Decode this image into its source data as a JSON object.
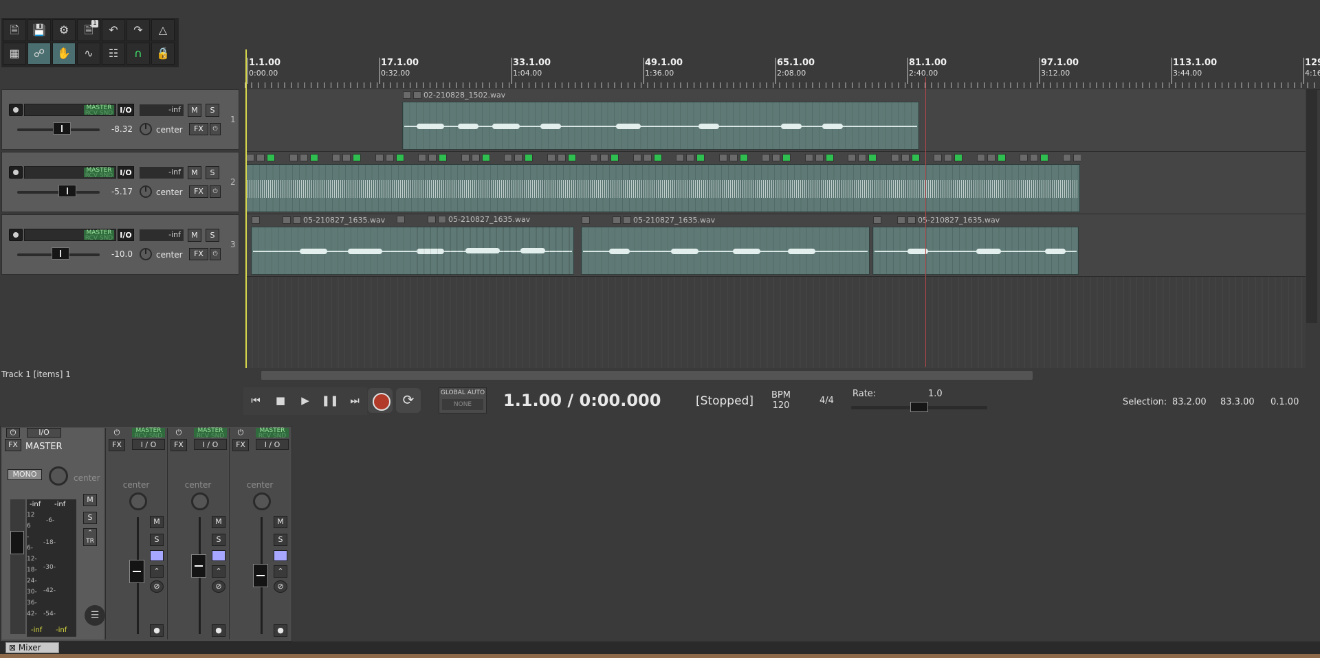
{
  "toolbar": {
    "row1": [
      "new-project",
      "save-project",
      "project-settings",
      "undo-history",
      "undo",
      "redo",
      "metronome"
    ],
    "row2": [
      "ripple-edit",
      "item-grouping",
      "envelope-points",
      "snap",
      "grid",
      "auto-crossfade",
      "lock"
    ],
    "lock_label": "LOCK",
    "undo_badge": "1"
  },
  "ruler": {
    "markers": [
      {
        "bar": "1.1.00",
        "time": "0:00.00"
      },
      {
        "bar": "17.1.00",
        "time": "0:32.00"
      },
      {
        "bar": "33.1.00",
        "time": "1:04.00"
      },
      {
        "bar": "49.1.00",
        "time": "1:36.00"
      },
      {
        "bar": "65.1.00",
        "time": "2:08.00"
      },
      {
        "bar": "81.1.00",
        "time": "2:40.00"
      },
      {
        "bar": "97.1.00",
        "time": "3:12.00"
      },
      {
        "bar": "113.1.00",
        "time": "3:44.00"
      },
      {
        "bar": "129",
        "time": "4:16"
      }
    ]
  },
  "tracks": [
    {
      "num": "1",
      "route": "MASTER",
      "route_sub": "RCV SND",
      "io": "I/O",
      "vol_readout": "-inf",
      "mute": "M",
      "solo": "S",
      "volume_db": "-8.32",
      "pan": "center",
      "fx": "FX",
      "fader_pos": 0.52
    },
    {
      "num": "2",
      "route": "MASTER",
      "route_sub": "RCV SND",
      "io": "I/O",
      "vol_readout": "-inf",
      "mute": "M",
      "solo": "S",
      "volume_db": "-5.17",
      "pan": "center",
      "fx": "FX",
      "fader_pos": 0.58
    },
    {
      "num": "3",
      "route": "MASTER",
      "route_sub": "RCV SND",
      "io": "I/O",
      "vol_readout": "-inf",
      "mute": "M",
      "solo": "S",
      "volume_db": "-10.0",
      "pan": "center",
      "fx": "FX",
      "fader_pos": 0.5
    }
  ],
  "items": {
    "track1": {
      "name": "02-210828_1502.wav"
    },
    "track3": [
      {
        "name": "05-210827_1635.wav"
      },
      {
        "name": "05-210827_1635.wav"
      },
      {
        "name": "05-210827_1635.wav"
      },
      {
        "name": "05-210827_1635.wav"
      }
    ]
  },
  "status": {
    "tcp_status": "Track 1 [items] 1"
  },
  "transport": {
    "position": "1.1.00 / 0:00.000",
    "state": "[Stopped]",
    "bpm_label": "BPM",
    "bpm_value": "120",
    "time_sig": "4/4",
    "rate_label": "Rate:",
    "rate_value": "1.0",
    "global_auto": "GLOBAL AUTO",
    "global_auto_mode": "NONE",
    "selection_label": "Selection:",
    "selection_start": "83.2.00",
    "selection_end": "83.3.00",
    "selection_length": "0.1.00"
  },
  "mixer": {
    "master": {
      "name": "MASTER",
      "fx": "FX",
      "io": "I/O",
      "mono": "MONO",
      "pan": "center",
      "mute": "M",
      "solo": "S",
      "tr": "TR",
      "meter_left_top": "-inf",
      "meter_right_top": "-inf",
      "meter_left_bottom": "-inf",
      "meter_right_bottom": "-inf",
      "scale_outer": [
        "12",
        "6",
        "-",
        "6-",
        "12-",
        "18-",
        "24-",
        "30-",
        "36-",
        "42-"
      ],
      "scale_inner": [
        "-6-",
        "-18-",
        "-30-",
        "-42-",
        "-54-"
      ]
    },
    "strips": [
      {
        "route": "MASTER",
        "route_sub": "RCV SND",
        "io": "I / O",
        "fx": "FX",
        "pan": "center",
        "mute": "M",
        "solo": "S"
      },
      {
        "route": "MASTER",
        "route_sub": "RCV SND",
        "io": "I / O",
        "fx": "FX",
        "pan": "center",
        "mute": "M",
        "solo": "S"
      },
      {
        "route": "MASTER",
        "route_sub": "RCV SND",
        "io": "I / O",
        "fx": "FX",
        "pan": "center",
        "mute": "M",
        "solo": "S"
      }
    ],
    "tab_label": "Mixer"
  },
  "colors": {
    "item": "#5f7a76",
    "route_green": "#2f6b3c",
    "play_cursor": "#d8d84c",
    "record": "#b13a28"
  }
}
